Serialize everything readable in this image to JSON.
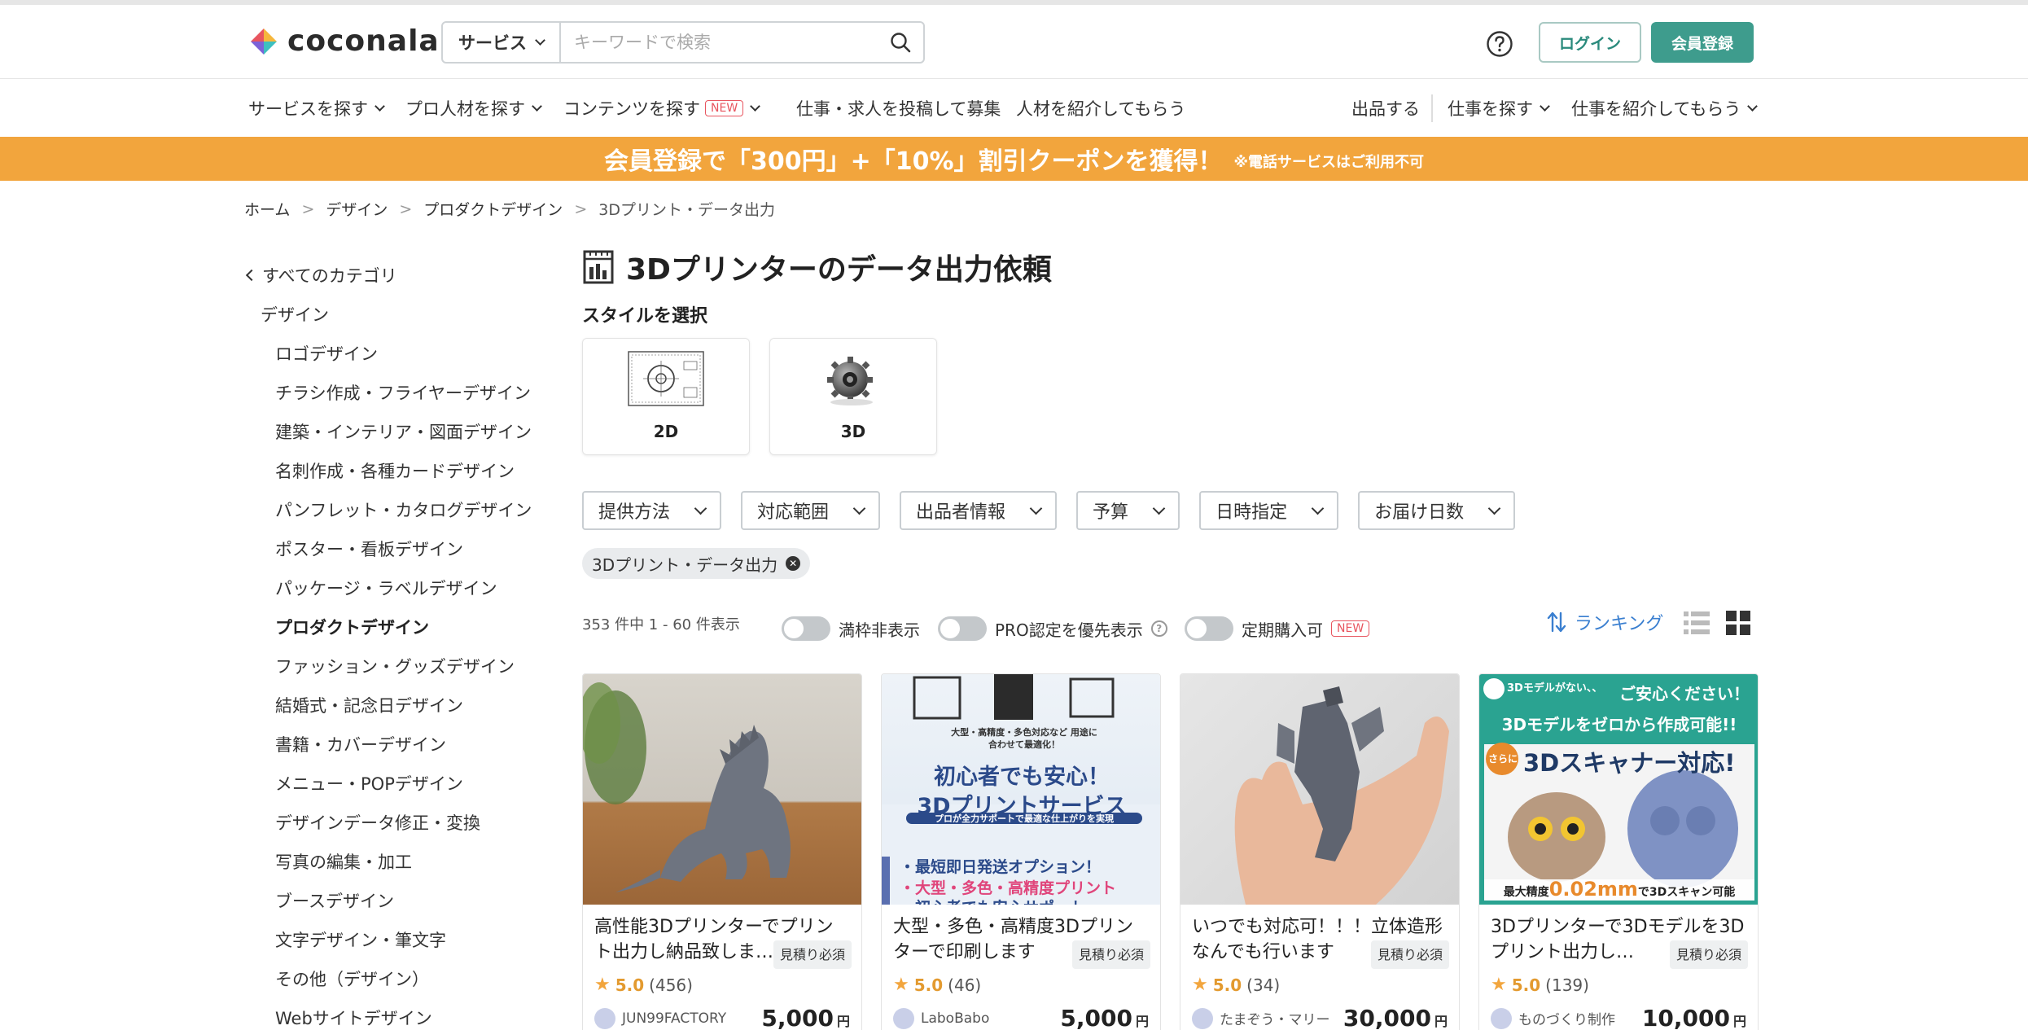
{
  "header": {
    "logo_text": "coconala",
    "search_select": "サービス",
    "search_placeholder": "キーワードで検索",
    "login_label": "ログイン",
    "signup_label": "会員登録"
  },
  "nav": {
    "left": [
      {
        "label": "サービスを探す",
        "dropdown": true
      },
      {
        "label": "プロ人材を探す",
        "dropdown": true
      },
      {
        "label": "コンテンツを探す",
        "badge": "NEW",
        "dropdown": true
      },
      {
        "label": "仕事・求人を投稿して募集",
        "dropdown": false
      },
      {
        "label": "人材を紹介してもらう",
        "dropdown": false
      }
    ],
    "right": [
      {
        "label": "出品する",
        "dropdown": false
      },
      {
        "label": "仕事を探す",
        "dropdown": true
      },
      {
        "label": "仕事を紹介してもらう",
        "dropdown": true
      }
    ]
  },
  "banner": {
    "main": "会員登録で「300円」+「10%」割引クーポンを獲得！",
    "note": "※電話サービスはご利用不可"
  },
  "breadcrumb": [
    "ホーム",
    "デザイン",
    "プロダクトデザイン",
    "3Dプリント・データ出力"
  ],
  "sidebar": {
    "back": "すべてのカテゴリ",
    "parent": "デザイン",
    "items": [
      "ロゴデザイン",
      "チラシ作成・フライヤーデザイン",
      "建築・インテリア・図面デザイン",
      "名刺作成・各種カードデザイン",
      "パンフレット・カタログデザイン",
      "ポスター・看板デザイン",
      "パッケージ・ラベルデザイン",
      "プロダクトデザイン",
      "ファッション・グッズデザイン",
      "結婚式・記念日デザイン",
      "書籍・カバーデザイン",
      "メニュー・POPデザイン",
      "デザインデータ修正・変換",
      "写真の編集・加工",
      "ブースデザイン",
      "文字デザイン・筆文字",
      "その他（デザイン）",
      "Webサイトデザイン"
    ],
    "active": "プロダクトデザイン"
  },
  "main": {
    "title": "3Dプリンターのデータ出力依頼",
    "style_label": "スタイルを選択",
    "styles": [
      "2D",
      "3D"
    ],
    "filters": [
      "提供方法",
      "対応範囲",
      "出品者情報",
      "予算",
      "日時指定",
      "お届け日数"
    ],
    "active_tag": "3Dプリント・データ出力",
    "count_text": "353 件中 1 - 60 件表示",
    "toggles": [
      {
        "label": "満枠非表示",
        "badge": ""
      },
      {
        "label": "PRO認定を優先表示",
        "badge": ""
      },
      {
        "label": "定期購入可",
        "badge": "NEW"
      }
    ],
    "help_mark": "?",
    "sort_label": "ランキング"
  },
  "cards": [
    {
      "title": "高性能3Dプリンターでプリント出力し納品致しま…",
      "estimate": "見積り必須",
      "score": "5.0",
      "reviews": "(456)",
      "seller": "JUN99FACTORY",
      "price": "5,000",
      "currency": "円"
    },
    {
      "title": "大型・多色・高精度3Dプリンターで印刷します",
      "estimate": "見積り必須",
      "score": "5.0",
      "reviews": "(46)",
      "seller": "LaboBabo",
      "price": "5,000",
      "currency": "円"
    },
    {
      "title": "いつでも対応可！！！立体造形なんでも行います",
      "estimate": "見積り必須",
      "score": "5.0",
      "reviews": "(34)",
      "seller": "たまぞう・マリー",
      "price": "30,000",
      "currency": "円"
    },
    {
      "title": "3Dプリンターで3Dモデルを3Dプリント出力し…",
      "estimate": "見積り必須",
      "score": "5.0",
      "reviews": "(139)",
      "seller": "ものづくり制作",
      "price": "10,000",
      "currency": "円"
    }
  ],
  "card2_overlay": {
    "small": "大型・高精度・多色対応など 用途に合わせて最適化！",
    "headline1": "初心者でも安心！",
    "headline2": "3Dプリントサービス",
    "strip": "プロが全力サポートで最適な仕上がりを実現",
    "bullet1": "・最短即日発送オプション！",
    "bullet2": "・大型・多色・高精度プリント",
    "bullet3": "・初心者でも安心サポート"
  },
  "card4_overlay": {
    "top_small": "3Dモデルがない、、",
    "top_right": "ご安心ください！",
    "line2": "3Dモデルをゼロから作成可能!!",
    "circle": "さらに",
    "line3": "3Dスキャナー対応!",
    "bottom_prefix": "最大精度",
    "bottom_value": "0.02mm",
    "bottom_suffix": "で3Dスキャン可能"
  },
  "colors": {
    "accent": "#3e9c8d",
    "banner": "#f2a53d",
    "link_blue": "#3a7fd0",
    "new_badge": "#e8555f"
  }
}
